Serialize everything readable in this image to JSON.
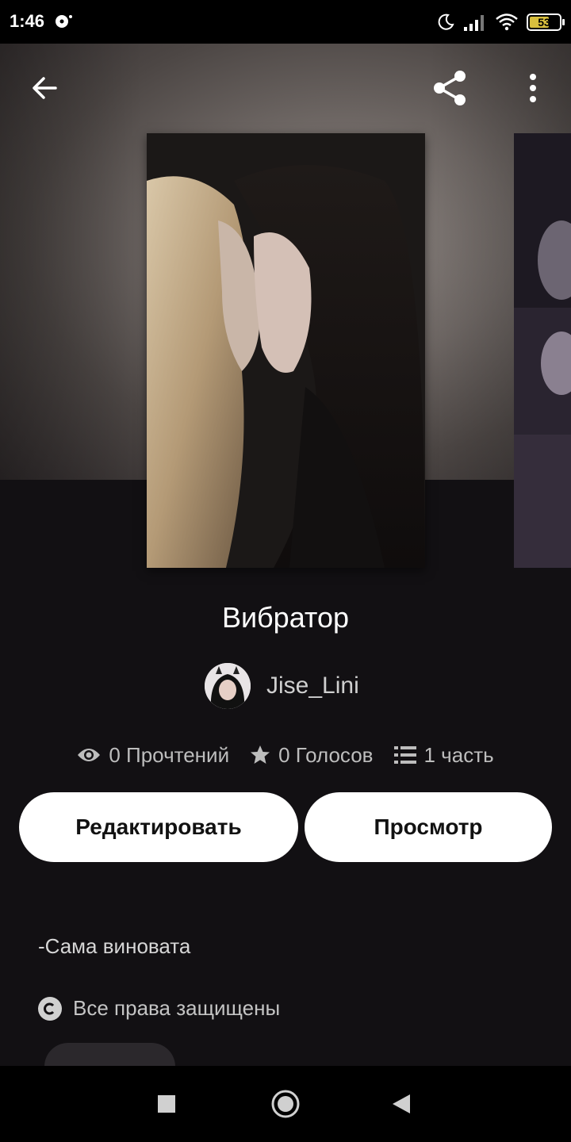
{
  "status_bar": {
    "time": "1:46",
    "battery_level": "53"
  },
  "header": {
    "back_icon": "arrow-left-icon",
    "share_icon": "share-icon",
    "more_icon": "more-vertical-icon"
  },
  "story": {
    "title": "Вибратор",
    "author": "Jise_Lini",
    "reads": "0 Прочтений",
    "votes": "0 Голосов",
    "parts": "1 часть",
    "description": "-Сама виновата",
    "rights": "Все права защищены"
  },
  "actions": {
    "edit_label": "Редактировать",
    "view_label": "Просмотр"
  },
  "colors": {
    "background": "#121013",
    "button_bg": "#ffffff",
    "battery_fill": "#d8bf3e"
  }
}
